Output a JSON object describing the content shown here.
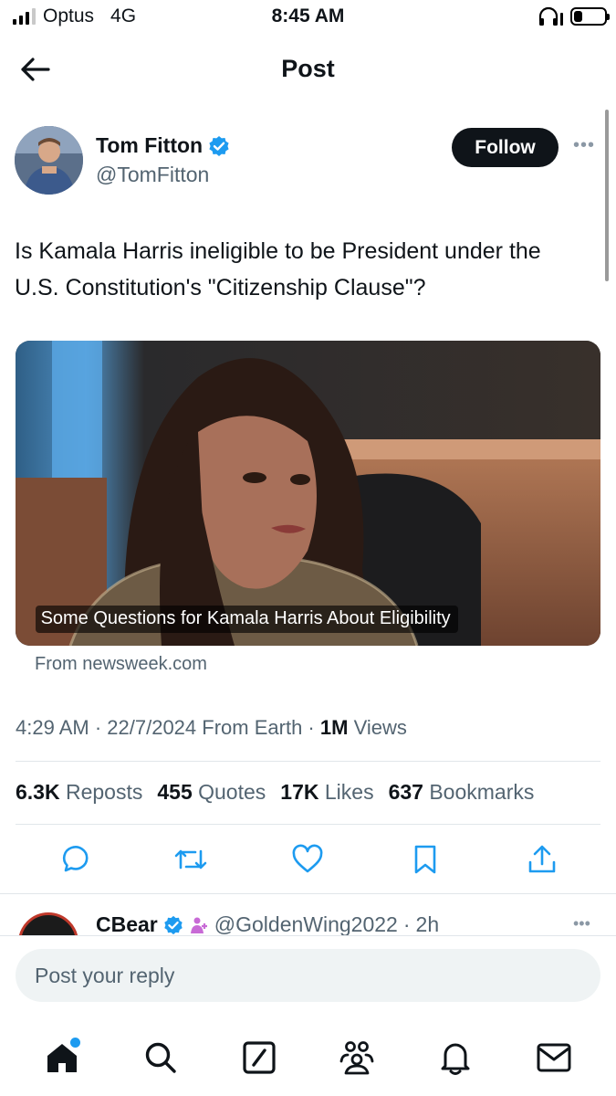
{
  "status_bar": {
    "carrier": "Optus",
    "network": "4G",
    "time": "8:45 AM"
  },
  "header": {
    "title": "Post",
    "back_icon": "arrow-left-icon"
  },
  "post": {
    "author": {
      "name": "Tom Fitton",
      "handle": "@TomFitton",
      "verified": true,
      "follow_label": "Follow"
    },
    "text": "Is Kamala Harris ineligible to be President under the U.S. Constitution's \"Citizenship Clause\"?",
    "link_card": {
      "title": "Some Questions for Kamala Harris About Eligibility",
      "source": "From newsweek.com"
    },
    "meta": {
      "time": "4:29 AM",
      "date": "22/7/2024",
      "location": "From Earth",
      "views_count": "1M",
      "views_label": "Views"
    },
    "stats": [
      {
        "count": "6.3K",
        "label": "Reposts"
      },
      {
        "count": "455",
        "label": "Quotes"
      },
      {
        "count": "17K",
        "label": "Likes"
      },
      {
        "count": "637",
        "label": "Bookmarks"
      }
    ],
    "actions": [
      "reply-icon",
      "repost-icon",
      "like-icon",
      "bookmark-icon",
      "share-icon"
    ]
  },
  "reply_preview": {
    "name": "CBear",
    "handle": "@GoldenWing2022",
    "time": "2h"
  },
  "reply_box": {
    "placeholder": "Post your reply"
  },
  "bottom_nav": [
    "home-icon",
    "search-icon",
    "grok-icon",
    "communities-icon",
    "notifications-icon",
    "messages-icon"
  ],
  "colors": {
    "accent": "#1d9bf0",
    "text": "#0f1419",
    "secondary": "#536471"
  }
}
